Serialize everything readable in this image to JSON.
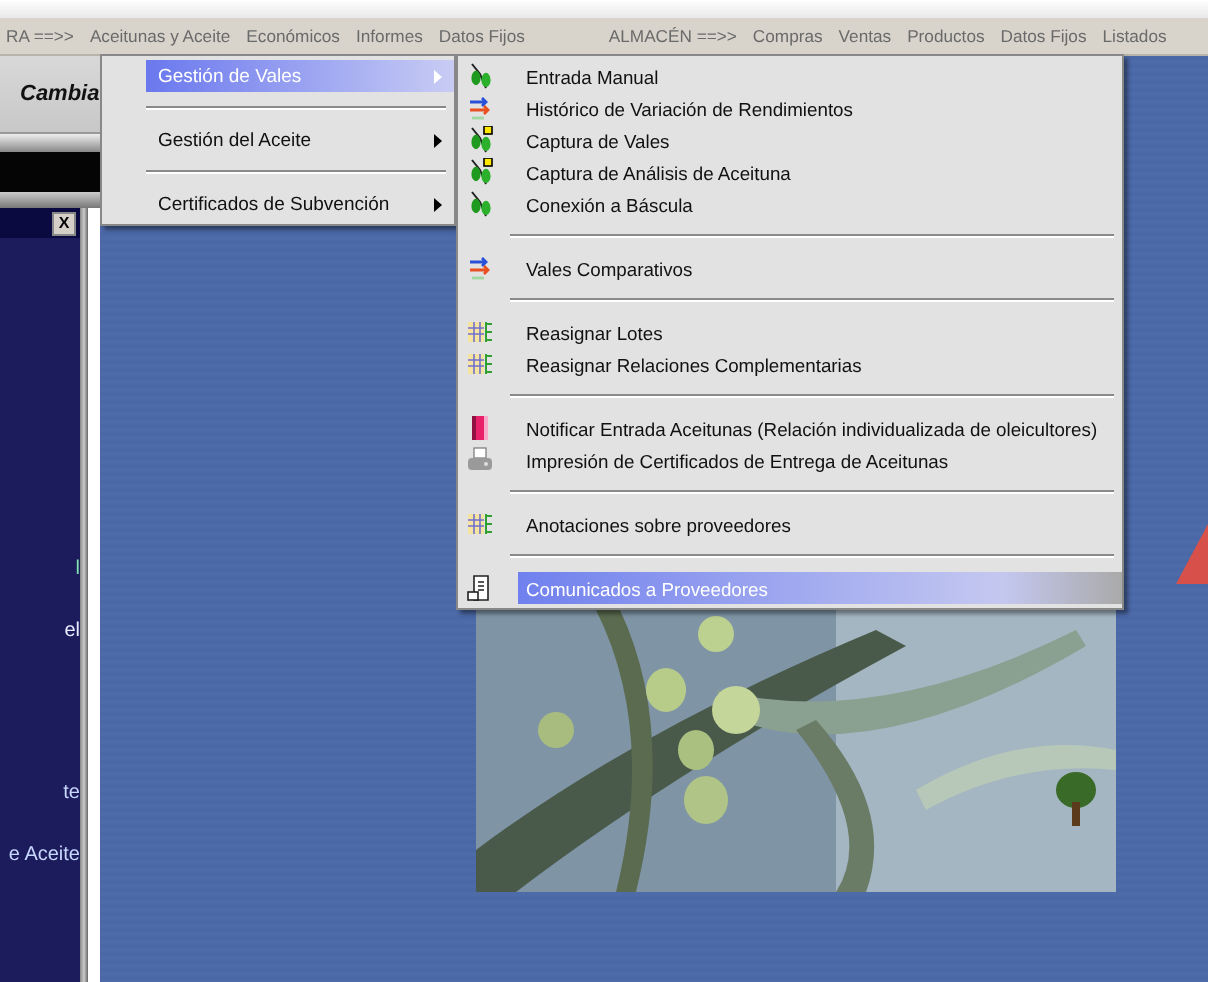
{
  "menu_bar": {
    "items": [
      {
        "label": "RA ==>>"
      },
      {
        "label": "Aceitunas y Aceite"
      },
      {
        "label": "Económicos"
      },
      {
        "label": "Informes"
      },
      {
        "label": "Datos Fijos"
      },
      {
        "label": "ALMACÉN ==>>"
      },
      {
        "label": "Compras"
      },
      {
        "label": "Ventas"
      },
      {
        "label": "Productos"
      },
      {
        "label": "Datos Fijos"
      },
      {
        "label": "Listados"
      }
    ]
  },
  "toolbar": {
    "label": "Cambia"
  },
  "side_panel": {
    "close": "X",
    "items": [
      {
        "label": "l",
        "color": "#7fe0b0"
      },
      {
        "label": "el",
        "color": "#e8ecff"
      },
      {
        "label": "te",
        "color": "#c8d8ff"
      },
      {
        "label": "e Aceite",
        "color": "#c8d8ff"
      }
    ]
  },
  "main_menu": {
    "items": [
      {
        "kind": "item",
        "label": "Gestión de Vales",
        "selected": true
      },
      {
        "kind": "separator"
      },
      {
        "kind": "item",
        "label": "Gestión del Aceite",
        "selected": false
      },
      {
        "kind": "separator"
      },
      {
        "kind": "item",
        "label": "Certificados de Subvención",
        "selected": false
      }
    ]
  },
  "submenu": {
    "items": [
      {
        "kind": "item",
        "label": "Entrada Manual",
        "selected": false
      },
      {
        "kind": "item",
        "label": "Histórico de Variación de Rendimientos",
        "selected": false
      },
      {
        "kind": "item",
        "label": "Captura de Vales",
        "selected": false
      },
      {
        "kind": "item",
        "label": "Captura de Análisis de Aceituna",
        "selected": false
      },
      {
        "kind": "item",
        "label": "Conexión a Báscula",
        "selected": false
      },
      {
        "kind": "separator"
      },
      {
        "kind": "item",
        "label": "Vales Comparativos",
        "selected": false
      },
      {
        "kind": "separator"
      },
      {
        "kind": "item",
        "label": "Reasignar Lotes",
        "selected": false
      },
      {
        "kind": "item",
        "label": "Reasignar Relaciones Complementarias",
        "selected": false
      },
      {
        "kind": "separator"
      },
      {
        "kind": "item",
        "label": "Notificar Entrada Aceitunas (Relación individualizada de oleicultores)",
        "selected": false
      },
      {
        "kind": "item",
        "label": "Impresión de Certificados de Entrega de Aceitunas",
        "selected": false
      },
      {
        "kind": "separator"
      },
      {
        "kind": "item",
        "label": "Anotaciones sobre proveedores",
        "selected": false
      },
      {
        "kind": "separator"
      },
      {
        "kind": "item",
        "label": "Comunicados a Proveedores",
        "selected": true
      }
    ]
  }
}
